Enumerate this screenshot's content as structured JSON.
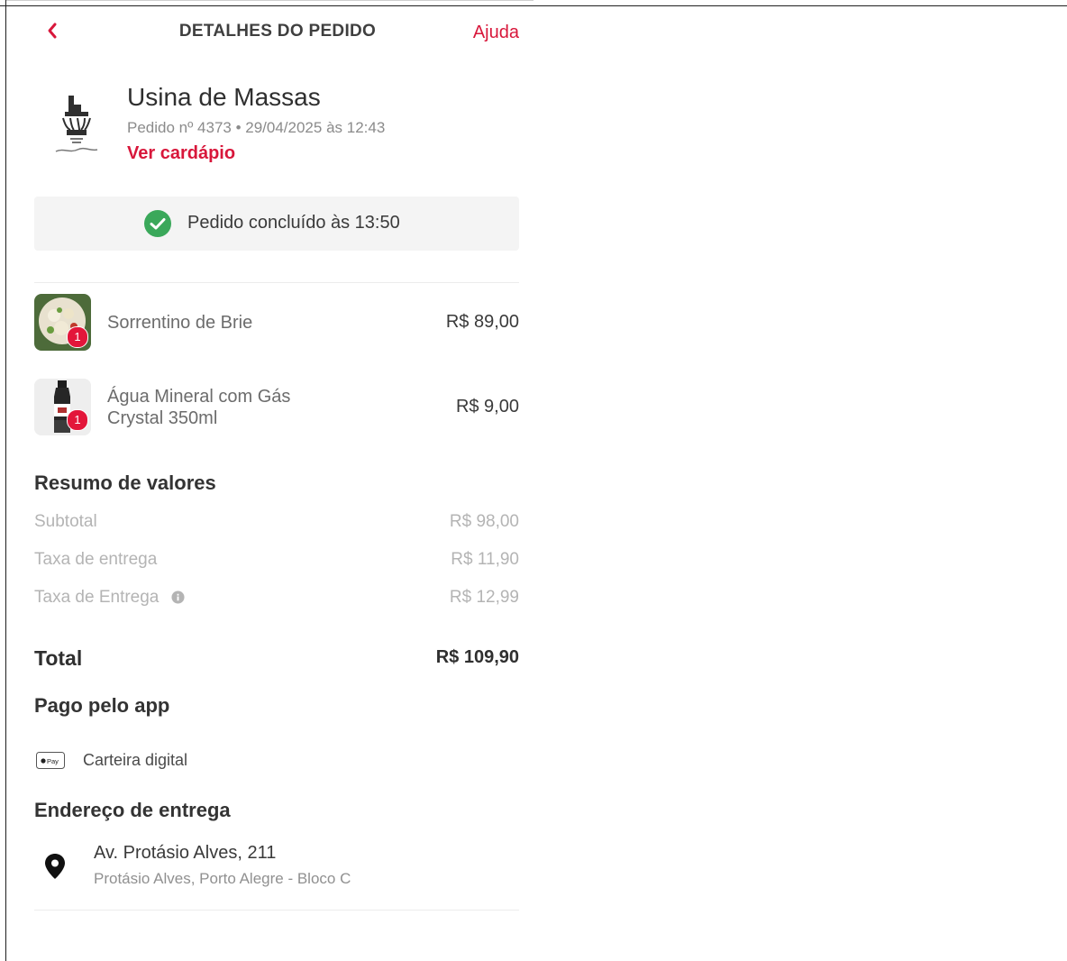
{
  "header": {
    "title": "DETALHES DO PEDIDO",
    "help_label": "Ajuda"
  },
  "restaurant": {
    "name": "Usina de Massas",
    "order_meta": "Pedido nº 4373 • 29/04/2025 às 12:43",
    "menu_link": "Ver cardápio"
  },
  "status": {
    "text": "Pedido concluído às 13:50",
    "color": "#3aa85a"
  },
  "items": [
    {
      "name": "Sorrentino de Brie",
      "price": "R$ 89,00",
      "qty": "1"
    },
    {
      "name_line1": "Água Mineral com Gás",
      "name_line2": "Crystal 350ml",
      "price": "R$ 9,00",
      "qty": "1"
    }
  ],
  "summary": {
    "title": "Resumo de valores",
    "rows": [
      {
        "label": "Subtotal",
        "value": "R$ 98,00"
      },
      {
        "label": "Taxa de entrega",
        "value": "R$ 11,90"
      },
      {
        "label": "Taxa de Entrega",
        "value": "R$ 12,99",
        "icon": "info-icon"
      }
    ],
    "total_label": "Total",
    "total_value": "R$ 109,90"
  },
  "payment": {
    "title": "Pago pelo app",
    "icon": "apple-pay-icon",
    "icon_text": "Pay",
    "method": "Carteira digital"
  },
  "delivery": {
    "title": "Endereço de entrega",
    "icon": "location-pin-icon",
    "address": "Av. Protásio Alves, 211",
    "details": "Protásio Alves, Porto Alegre - Bloco C"
  },
  "colors": {
    "accent": "#d8173b",
    "badge": "#e3163a"
  }
}
